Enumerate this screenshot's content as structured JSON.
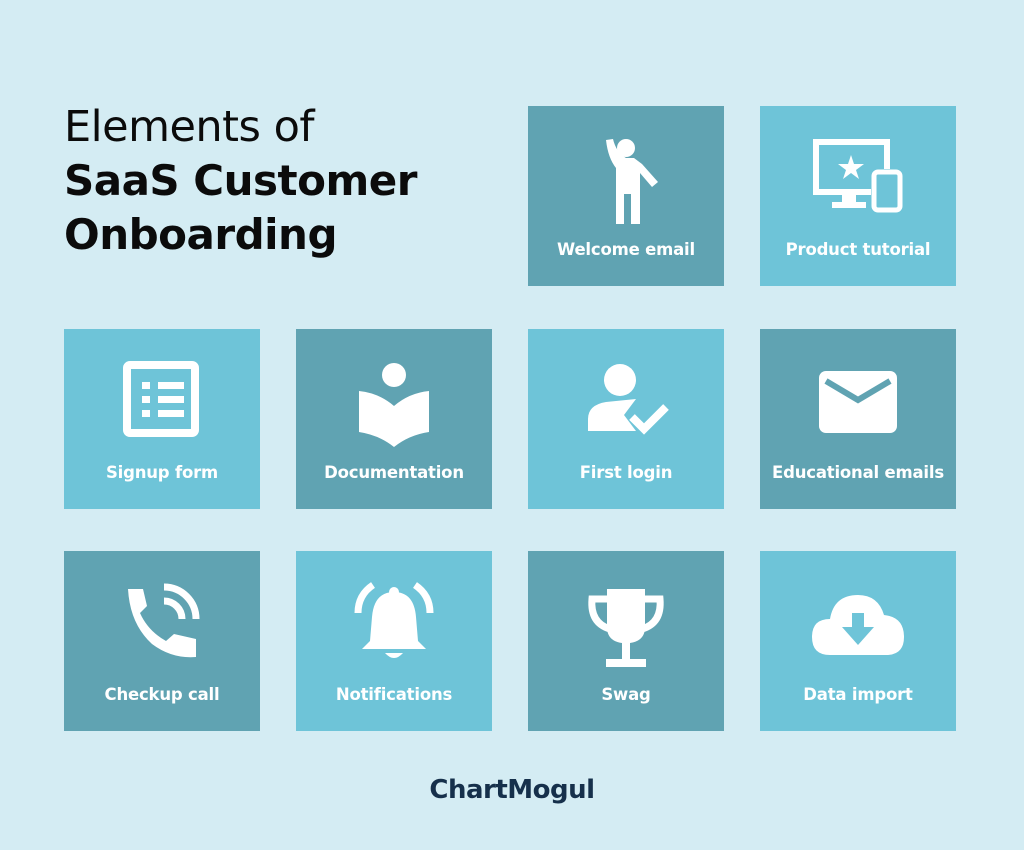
{
  "title": {
    "line1": "Elements of",
    "line2": "SaaS Customer",
    "line3": "Onboarding"
  },
  "colors": {
    "background": "#d4ecf3",
    "tile_dark": "#60a3b2",
    "tile_light": "#6ec4d8",
    "title_text": "#0b0b0b",
    "logo_text": "#16304b"
  },
  "tiles": [
    {
      "label": "Welcome email",
      "icon": "waving-person-icon",
      "shade": "dark"
    },
    {
      "label": "Product tutorial",
      "icon": "monitor-phone-star-icon",
      "shade": "light"
    },
    {
      "label": "Signup form",
      "icon": "form-list-icon",
      "shade": "light"
    },
    {
      "label": "Documentation",
      "icon": "reader-book-icon",
      "shade": "dark"
    },
    {
      "label": "First login",
      "icon": "user-check-icon",
      "shade": "light"
    },
    {
      "label": "Educational emails",
      "icon": "envelope-icon",
      "shade": "dark"
    },
    {
      "label": "Checkup call",
      "icon": "phone-call-icon",
      "shade": "dark"
    },
    {
      "label": "Notifications",
      "icon": "ringing-bell-icon",
      "shade": "light"
    },
    {
      "label": "Swag",
      "icon": "trophy-icon",
      "shade": "dark"
    },
    {
      "label": "Data import",
      "icon": "cloud-download-icon",
      "shade": "light"
    }
  ],
  "footer": {
    "logo": "ChartMogul"
  }
}
